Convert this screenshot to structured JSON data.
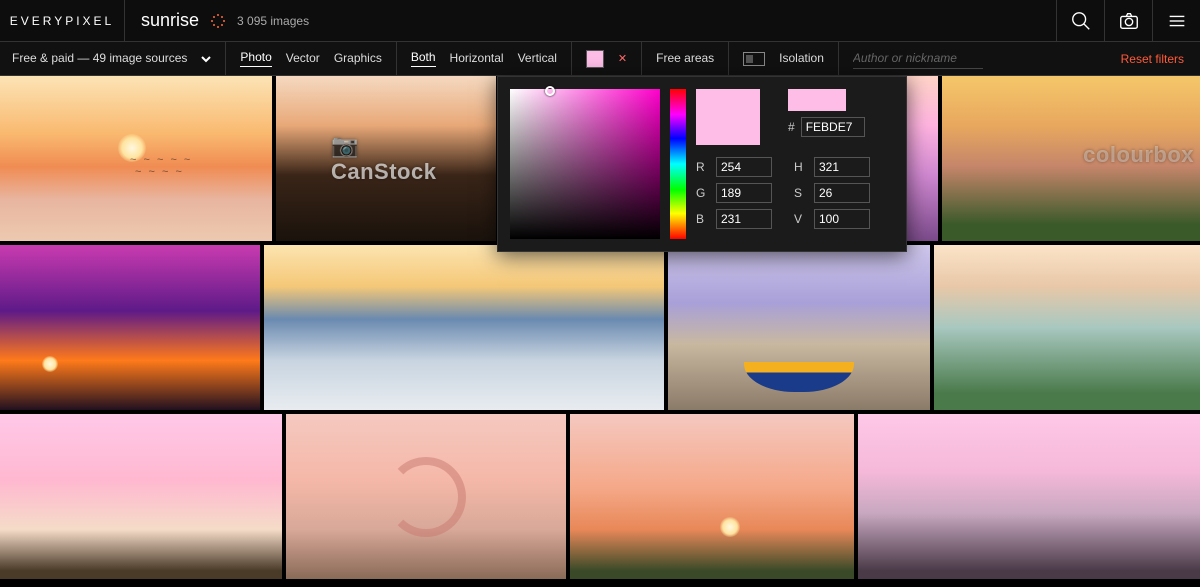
{
  "header": {
    "logo": "EVERYPIXEL",
    "search_term": "sunrise",
    "image_count": "3 095 images"
  },
  "filters": {
    "sources_label": "Free & paid — 49 image sources",
    "type": {
      "photo": "Photo",
      "vector": "Vector",
      "graphics": "Graphics"
    },
    "orientation": {
      "both": "Both",
      "horizontal": "Horizontal",
      "vertical": "Vertical"
    },
    "free_areas_label": "Free areas",
    "isolation_label": "Isolation",
    "author_placeholder": "Author or nickname",
    "reset_label": "Reset filters",
    "clear_color": "✕"
  },
  "color_picker": {
    "swatch_hex": "#FEBDE7",
    "hex_value": "FEBDE7",
    "hash": "#",
    "r_label": "R",
    "g_label": "G",
    "b_label": "B",
    "h_label": "H",
    "s_label": "S",
    "v_label": "V",
    "r": "254",
    "g": "189",
    "b": "231",
    "h": "321",
    "s": "26",
    "v": "100"
  },
  "watermarks": {
    "canstock": "CanStock",
    "colourbox": "colourbox"
  }
}
